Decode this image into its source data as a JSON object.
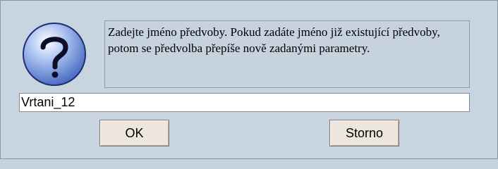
{
  "dialog": {
    "icon": "question-mark-icon",
    "message": "Zadejte jméno předvoby. Pokud zadáte jméno již existující předvoby, potom se předvolba přepíše nově zadanými parametry.",
    "input_value": "Vrtani_12",
    "ok_label": "OK",
    "cancel_label": "Storno"
  },
  "colors": {
    "background": "#c8d4e0",
    "icon_fill": "#6f8fd6",
    "button_face": "#ece6df"
  }
}
